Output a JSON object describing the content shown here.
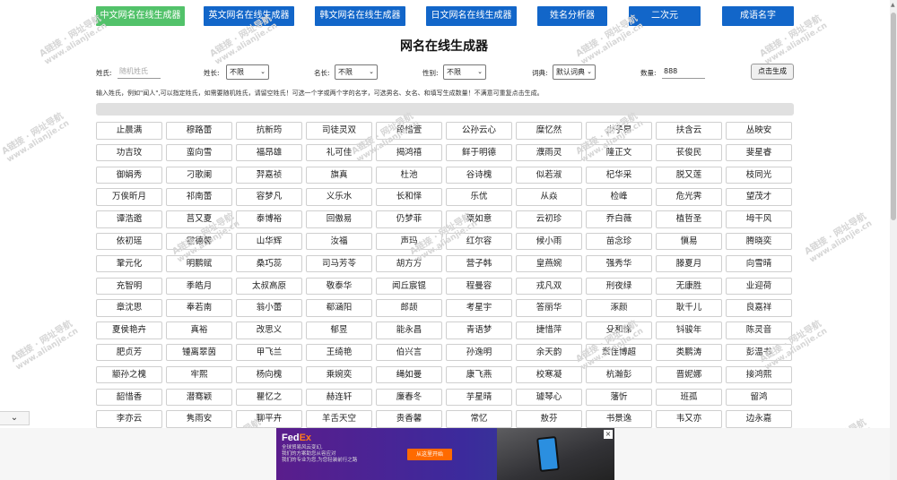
{
  "nav": [
    {
      "label": "中文网名在线生成器",
      "active": true
    },
    {
      "label": "英文网名在线生成器",
      "active": false
    },
    {
      "label": "韩文网名在线生成器",
      "active": false
    },
    {
      "label": "日文网名在线生成器",
      "active": false
    },
    {
      "label": "姓名分析器",
      "active": false
    },
    {
      "label": "二次元",
      "active": false
    },
    {
      "label": "成语名字",
      "active": false
    }
  ],
  "watermark": {
    "name": "A链接 · 网址导航",
    "url": "www.alianjie.cn"
  },
  "page_title": "网名在线生成器",
  "form": {
    "surname_label": "姓氏:",
    "surname_placeholder": "随机姓氏",
    "surname_len_label": "姓长:",
    "surname_len_value": "不限",
    "name_len_label": "名长:",
    "name_len_value": "不限",
    "gender_label": "性别:",
    "gender_value": "不限",
    "dict_label": "词典:",
    "dict_value": "默认词典",
    "count_label": "数量:",
    "count_value": "888",
    "generate_button": "点击生成"
  },
  "hint": "输入姓氏，例如\"闻人\",可以指定姓氏，如需要随机姓氏，请留空姓氏！可选一个字或两个字的名字，可选男名、女名、和填写生成数量！不满意可重复点击生成。",
  "names": [
    "止晨满",
    "穆路蕾",
    "抗新筠",
    "司徒灵双",
    "段惜萱",
    "公孙云心",
    "糜忆然",
    "少子昂",
    "扶含云",
    "丛映安",
    "功吉玟",
    "蛮向雪",
    "福昂雄",
    "礼可佳",
    "揭鸿禧",
    "鲜于明德",
    "濮雨灵",
    "隆正文",
    "苌俊民",
    "斐星睿",
    "御娟秀",
    "刁歌阑",
    "羿嘉祯",
    "旗真",
    "杜池",
    "谷诗槐",
    "似若淑",
    "杞华采",
    "脱又莲",
    "枝同光",
    "万俟昕月",
    "祁南蕾",
    "容梦凡",
    "义乐水",
    "长和怿",
    "乐优",
    "从焱",
    "检峰",
    "危光霁",
    "望茂才",
    "谭浩邈",
    "莒又夏",
    "泰博裕",
    "回傲易",
    "仍梦菲",
    "栗如意",
    "云初珍",
    "乔白薇",
    "植哲圣",
    "坶干风",
    "依初瑶",
    "霍德馨",
    "山华辉",
    "汝福",
    "声玛",
    "红尔容",
    "候小雨",
    "苗念珍",
    "愼易",
    "腾晓奕",
    "鞏元化",
    "明鹏赋",
    "桑巧蕊",
    "司马芳苓",
    "胡方方",
    "营子韩",
    "皇燕婉",
    "强秀华",
    "滕夏月",
    "向雪晴",
    "充智明",
    "季皓月",
    "太叔高原",
    "敬泰华",
    "闻丘宸锟",
    "程曼容",
    "戎凡双",
    "刑夜绿",
    "无康胜",
    "业迎荷",
    "章沈思",
    "奉若南",
    "翁小蕾",
    "郗涵阳",
    "郎颉",
    "考星宇",
    "答丽华",
    "涿颜",
    "耿千儿",
    "良嘉祥",
    "夏侯艳卉",
    "真裕",
    "改思义",
    "郁昱",
    "能永昌",
    "青语梦",
    "捷惜萍",
    "殳和悌",
    "钭骏年",
    "陈灵音",
    "肥贞芳",
    "锺离翠茵",
    "甲飞兰",
    "王绮艳",
    "伯兴言",
    "孙逸明",
    "余天韵",
    "章佳博超",
    "类鹏涛",
    "彭温书",
    "颛孙之槐",
    "牢熙",
    "杨向槐",
    "乘婉奕",
    "绳如曼",
    "康飞燕",
    "校寒凝",
    "杭瀚彭",
    "晋妮娜",
    "接鸿熙",
    "韶惜香",
    "潜骞颖",
    "瞿忆之",
    "赫连轩",
    "廉春冬",
    "芋星晴",
    "璩琴心",
    "藩忻",
    "班孤",
    "留鸿",
    "李亦云",
    "隽雨安",
    "聊平卉",
    "羊舌天空",
    "贵香馨",
    "常忆",
    "敖芬",
    "书景逸",
    "韦又亦",
    "边永嘉"
  ],
  "ad": {
    "logo_a": "Fed",
    "logo_b": "Ex",
    "lines": [
      "全球贸易风云变幻,",
      "我们的方案助您从容应对",
      "我们的专业为您,为您轻装前行之路"
    ],
    "cta": "从这里开始"
  },
  "collapse_icon": "chevron-down-icon"
}
